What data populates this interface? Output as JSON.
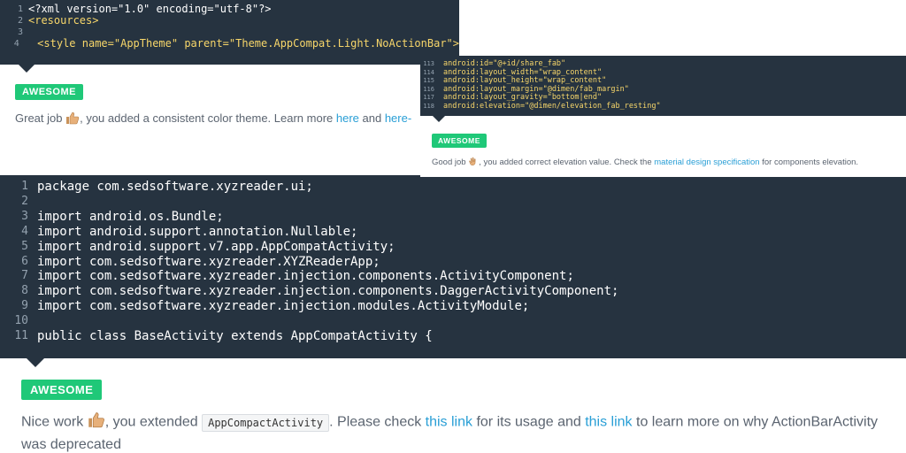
{
  "panel1": {
    "code_lines": [
      {
        "n": "1",
        "text": "<?xml version=\"1.0\" encoding=\"utf-8\"?>"
      },
      {
        "n": "2",
        "text": "<resources>"
      },
      {
        "n": "3",
        "text": ""
      },
      {
        "n": "4",
        "text": "  <style name=\"AppTheme\" parent=\"Theme.AppCompat.Light.NoActionBar\">"
      }
    ],
    "badge": "AWESOME",
    "review_prefix": "Great job ",
    "review_middle": ", you added a consistent color theme. Learn more ",
    "link1": "here",
    "review_and": " and ",
    "link2": "here-"
  },
  "panel2": {
    "code_lines": [
      {
        "n": "113",
        "text": "android:id=\"@+id/share_fab\""
      },
      {
        "n": "114",
        "text": "android:layout_width=\"wrap_content\""
      },
      {
        "n": "115",
        "text": "android:layout_height=\"wrap_content\""
      },
      {
        "n": "116",
        "text": "android:layout_margin=\"@dimen/fab_margin\""
      },
      {
        "n": "117",
        "text": "android:layout_gravity=\"bottom|end\""
      },
      {
        "n": "118",
        "text": "android:elevation=\"@dimen/elevation_fab_resting\""
      }
    ],
    "badge": "AWESOME",
    "review_prefix": "Good job ",
    "review_middle": ", you added correct elevation value. Check the ",
    "link1": "material design specification",
    "review_suffix": " for components elevation."
  },
  "panel3": {
    "code_lines": [
      {
        "n": "1",
        "text": "package com.sedsoftware.xyzreader.ui;"
      },
      {
        "n": "2",
        "text": ""
      },
      {
        "n": "3",
        "text": "import android.os.Bundle;"
      },
      {
        "n": "4",
        "text": "import android.support.annotation.Nullable;"
      },
      {
        "n": "5",
        "text": "import android.support.v7.app.AppCompatActivity;"
      },
      {
        "n": "6",
        "text": "import com.sedsoftware.xyzreader.XYZReaderApp;"
      },
      {
        "n": "7",
        "text": "import com.sedsoftware.xyzreader.injection.components.ActivityComponent;"
      },
      {
        "n": "8",
        "text": "import com.sedsoftware.xyzreader.injection.components.DaggerActivityComponent;"
      },
      {
        "n": "9",
        "text": "import com.sedsoftware.xyzreader.injection.modules.ActivityModule;"
      },
      {
        "n": "10",
        "text": ""
      },
      {
        "n": "11",
        "text": "public class BaseActivity extends AppCompatActivity {"
      }
    ],
    "badge": "AWESOME",
    "review_prefix": "Nice work ",
    "review_middle": ", you extended ",
    "inline_code": "AppCompactActivity",
    "review_after_code": ". Please check ",
    "link1": "this link",
    "review_for": " for its usage and ",
    "link2": "this link",
    "review_suffix": " to learn more on why ActionBarActivity was deprecated"
  },
  "colors": {
    "code_bg": "#263340",
    "badge_bg": "#1fc878",
    "link": "#2a9fd6",
    "code_highlight": "#f7d66a"
  },
  "icons": {
    "thumbs_up": "thumbs-up-icon",
    "clapping": "clapping-hands-icon"
  }
}
